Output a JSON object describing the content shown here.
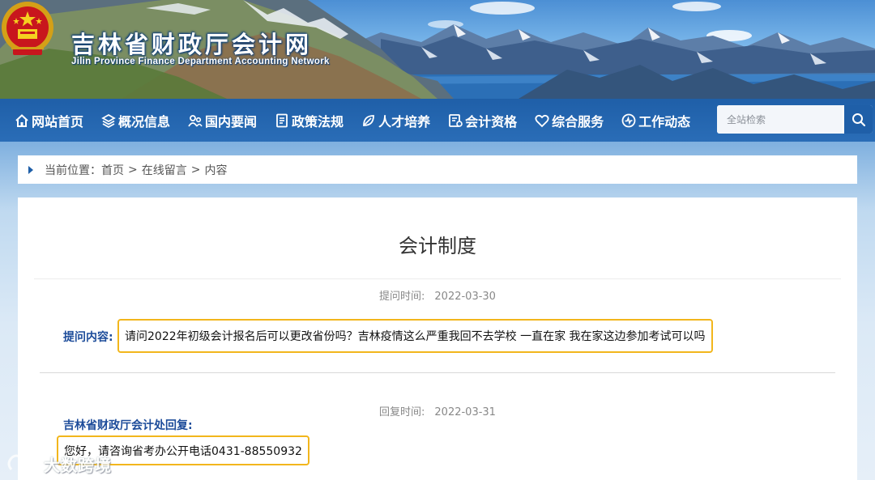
{
  "header": {
    "title": "吉林省财政厅会计网",
    "subtitle": "Jilin Province Finance Department Accounting Network"
  },
  "nav": {
    "items": [
      {
        "label": "网站首页",
        "icon": "home-icon"
      },
      {
        "label": "概况信息",
        "icon": "layers-icon"
      },
      {
        "label": "国内要闻",
        "icon": "people-icon"
      },
      {
        "label": "政策法规",
        "icon": "document-icon"
      },
      {
        "label": "人才培养",
        "icon": "leaf-icon"
      },
      {
        "label": "会计资格",
        "icon": "certificate-icon"
      },
      {
        "label": "综合服务",
        "icon": "heart-icon"
      },
      {
        "label": "工作动态",
        "icon": "activity-icon"
      }
    ],
    "search": {
      "placeholder": "全站检索",
      "icon": "search-icon"
    }
  },
  "breadcrumb": {
    "prefix": "当前位置：",
    "items": [
      "首页",
      "在线留言",
      "内容"
    ],
    "separator": ">"
  },
  "article": {
    "title": "会计制度",
    "question_time_label": "提问时间:",
    "question_time": "2022-03-30",
    "question_label": "提问内容:",
    "question_text": "请问2022年初级会计报名后可以更改省份吗？吉林疫情这么严重我回不去学校 一直在家 我在家这边参加考试可以吗",
    "reply_time_label": "回复时间:",
    "reply_time": "2022-03-31",
    "reply_label": "吉林省财政厅会计处回复:",
    "reply_text": "您好，请咨询省考办公开电话0431-88550932"
  },
  "watermark": {
    "text": "大数跨境"
  },
  "colors": {
    "nav_bg": "#1f5fa8",
    "label_blue": "#1d4c9a",
    "highlight_border": "#f2b61c"
  }
}
